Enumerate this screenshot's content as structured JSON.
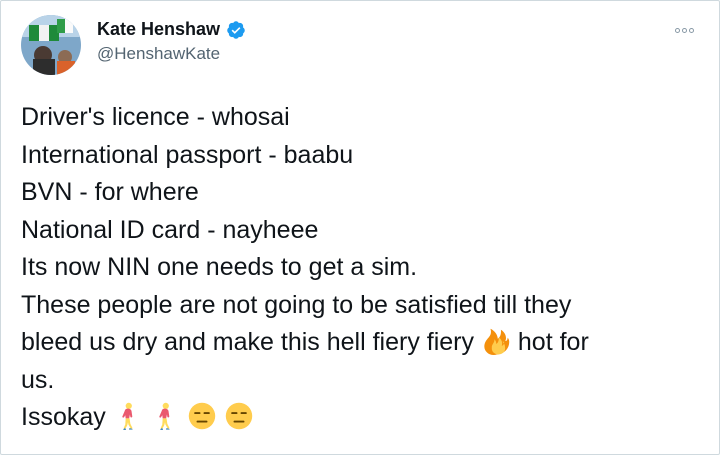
{
  "author": {
    "display_name": "Kate Henshaw",
    "handle": "@HenshawKate"
  },
  "tweet": {
    "lines": [
      "Driver's licence - whosai",
      "International passport - baabu",
      "BVN  - for where",
      "National ID card - nayheee",
      "Its now NIN one needs to get a sim.",
      "These people are not going to be satisfied till they",
      "bleed us dry and make this hell fiery fiery",
      "hot for",
      "us.",
      "Issokay"
    ],
    "emojis": [
      "fire-emoji",
      "person-walking-emoji",
      "person-walking-emoji",
      "expressionless-face-emoji",
      "expressionless-face-emoji"
    ]
  },
  "colors": {
    "verified": "#1d9bf0",
    "secondary_text": "#536471",
    "border": "#cfd9de"
  }
}
